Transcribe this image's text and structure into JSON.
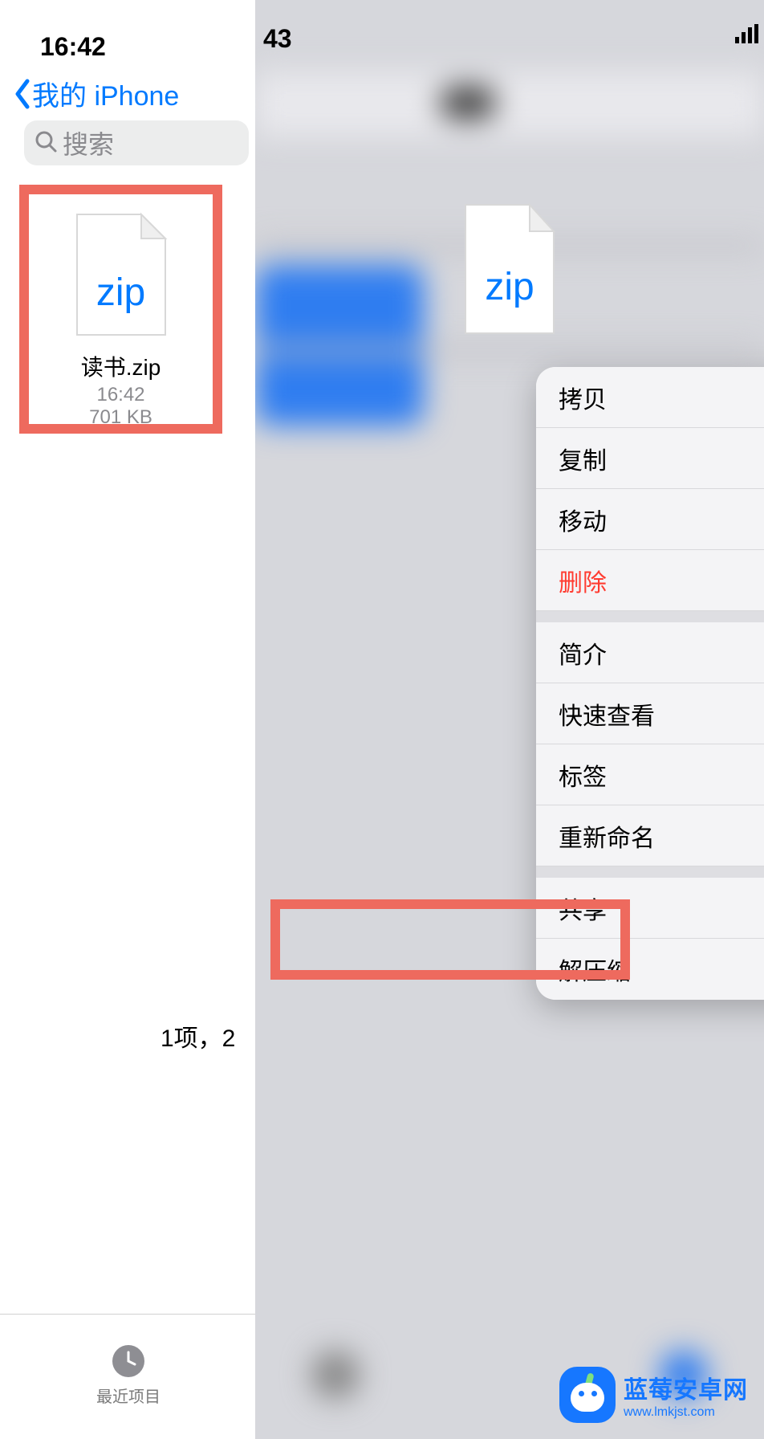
{
  "left": {
    "clock": "16:42",
    "back_label": "我的 iPhone",
    "search_placeholder": "搜索",
    "file": {
      "ext": "zip",
      "name": "读书.zip",
      "time": "16:42",
      "size": "701 KB"
    },
    "count": "1项，2",
    "recent_label": "最近项目"
  },
  "right": {
    "clock_fragment": "43",
    "zip_ext": "zip",
    "menu": {
      "copy": "拷贝",
      "duplicate": "复制",
      "move": "移动",
      "delete": "删除",
      "info": "简介",
      "quicklook": "快速查看",
      "tags": "标签",
      "rename": "重新命名",
      "share": "共享",
      "uncompress": "解压缩"
    }
  },
  "watermark": {
    "title": "蓝莓安卓网",
    "sub": "www.lmkjst.com"
  }
}
